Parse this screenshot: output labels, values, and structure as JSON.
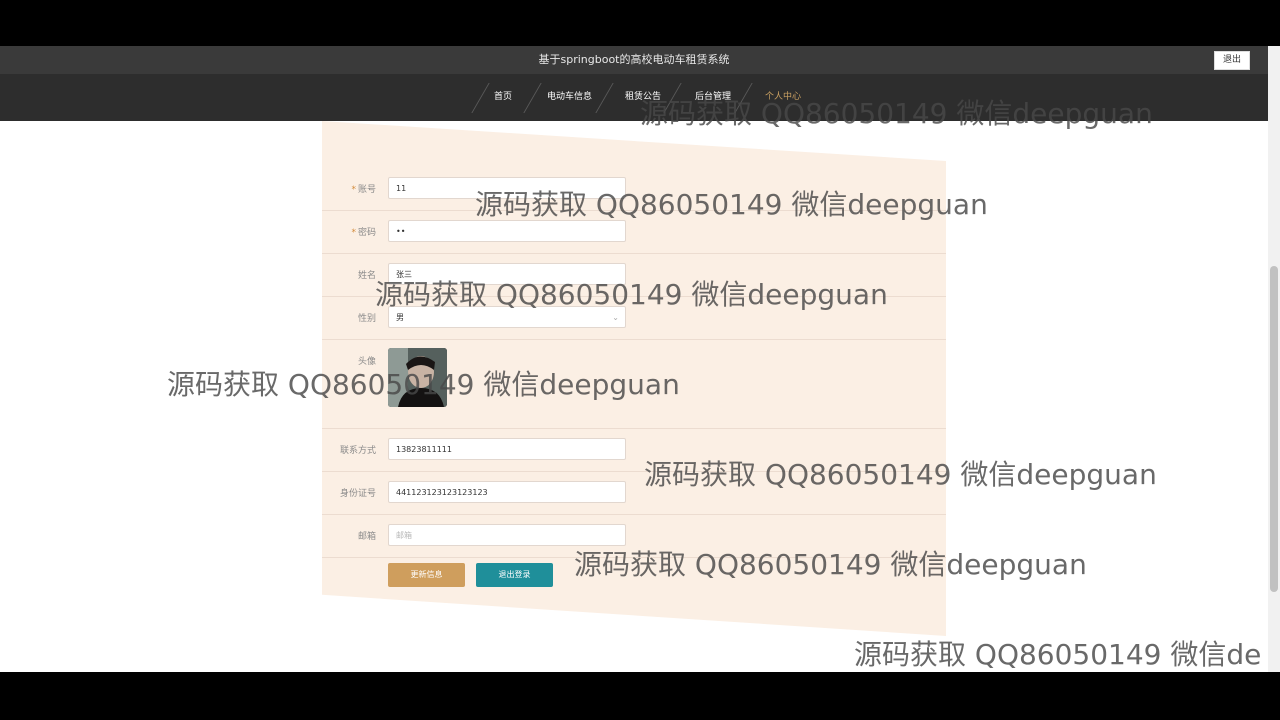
{
  "window": {
    "title": "基于springboot的高校电动车租赁系统",
    "logout_button": "退出"
  },
  "nav": {
    "items": [
      {
        "label": "首页",
        "active": false
      },
      {
        "label": "电动车信息",
        "active": false
      },
      {
        "label": "租赁公告",
        "active": false
      },
      {
        "label": "后台管理",
        "active": false
      },
      {
        "label": "个人中心",
        "active": true
      }
    ]
  },
  "form": {
    "account": {
      "label": "账号",
      "value": "11",
      "required": true
    },
    "password": {
      "label": "密码",
      "value": "••",
      "required": true
    },
    "name": {
      "label": "姓名",
      "value": "张三"
    },
    "gender": {
      "label": "性别",
      "value": "男"
    },
    "avatar": {
      "label": "头像"
    },
    "phone": {
      "label": "联系方式",
      "value": "13823811111"
    },
    "idcard": {
      "label": "身份证号",
      "value": "441123123123123123"
    },
    "email": {
      "label": "邮箱",
      "placeholder": "邮箱"
    },
    "buttons": {
      "update": "更新信息",
      "logout": "退出登录"
    }
  },
  "watermarks": [
    "源码获取 QQ86050149 微信deepguan",
    "源码获取 QQ86050149 微信deepguan",
    "源码获取 QQ86050149 微信deepguan",
    "源码获取 QQ86050149 微信deepguan",
    "源码获取 QQ86050149 微信deepguan",
    "源码获取 QQ86050149 微信deepguan",
    "源码获取 QQ86050149 微信de"
  ],
  "colors": {
    "accent": "#c9a062",
    "update_button": "#cf9e5d",
    "logout_button": "#1f8f9a",
    "panel": "#fbefe4"
  }
}
